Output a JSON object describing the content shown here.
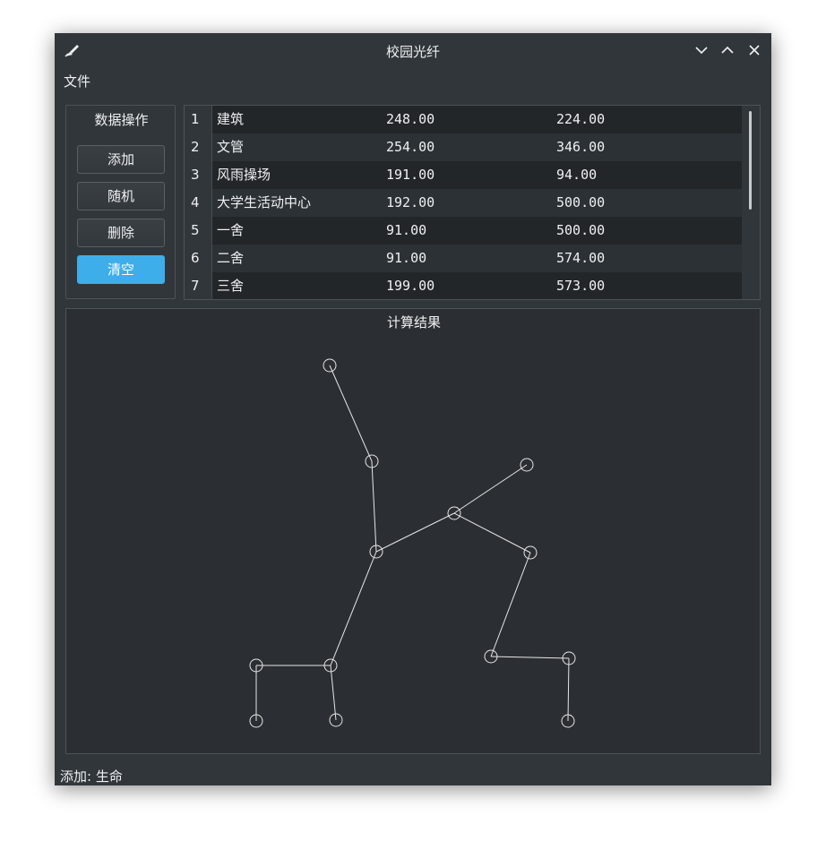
{
  "window": {
    "title": "校园光纤",
    "icons": {
      "app": "pen-tool-icon",
      "minimize": "chevron-down-icon",
      "maximize": "chevron-up-icon",
      "close": "close-icon"
    }
  },
  "menu": {
    "file": "文件"
  },
  "data_ops": {
    "title": "数据操作",
    "add": "添加",
    "random": "随机",
    "delete": "删除",
    "clear": "清空"
  },
  "table": {
    "rows": [
      {
        "num": "1",
        "name": "建筑",
        "x": "248.00",
        "y": "224.00"
      },
      {
        "num": "2",
        "name": "文管",
        "x": "254.00",
        "y": "346.00"
      },
      {
        "num": "3",
        "name": "风雨操场",
        "x": "191.00",
        "y": "94.00"
      },
      {
        "num": "4",
        "name": "大学生活动中心",
        "x": "192.00",
        "y": "500.00"
      },
      {
        "num": "5",
        "name": "一舍",
        "x": "91.00",
        "y": "500.00"
      },
      {
        "num": "6",
        "name": "二舍",
        "x": "91.00",
        "y": "574.00"
      },
      {
        "num": "7",
        "name": "三舍",
        "x": "199.00",
        "y": "573.00"
      }
    ]
  },
  "result": {
    "title": "计算结果"
  },
  "status": {
    "text": "添加: 生命"
  },
  "colors": {
    "accent": "#3daee9",
    "background": "#31363b",
    "graph_line": "#e6e6e6"
  }
}
